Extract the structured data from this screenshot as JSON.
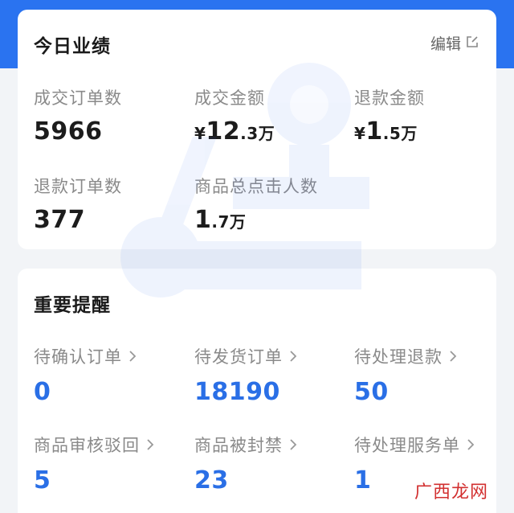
{
  "today_performance": {
    "title": "今日业绩",
    "edit_label": "编辑",
    "metrics": [
      {
        "label": "成交订单数",
        "value": "5966",
        "currency": "",
        "main": "5966",
        "decimal": "",
        "unit": ""
      },
      {
        "label": "成交金额",
        "value": "¥12.3万",
        "currency": "¥",
        "main": "12",
        "decimal": ".3",
        "unit": "万"
      },
      {
        "label": "退款金额",
        "value": "¥1.5万",
        "currency": "¥",
        "main": "1",
        "decimal": ".5",
        "unit": "万"
      },
      {
        "label": "退款订单数",
        "value": "377",
        "currency": "",
        "main": "377",
        "decimal": "",
        "unit": ""
      },
      {
        "label": "商品总点击人数",
        "value": "1.7万",
        "currency": "",
        "main": "1",
        "decimal": ".7",
        "unit": "万"
      }
    ]
  },
  "important_reminders": {
    "title": "重要提醒",
    "items": [
      {
        "label": "待确认订单",
        "value": "0"
      },
      {
        "label": "待发货订单",
        "value": "18190"
      },
      {
        "label": "待处理退款",
        "value": "50"
      },
      {
        "label": "商品审核驳回",
        "value": "5"
      },
      {
        "label": "商品被封禁",
        "value": "23"
      },
      {
        "label": "待处理服务单",
        "value": "1"
      }
    ]
  },
  "watermark_logo": {
    "text": "广西龙网"
  },
  "colors": {
    "header_blue": "#2a73f0",
    "value_blue": "#2a6fe6",
    "label_gray": "#8a8a8a"
  }
}
